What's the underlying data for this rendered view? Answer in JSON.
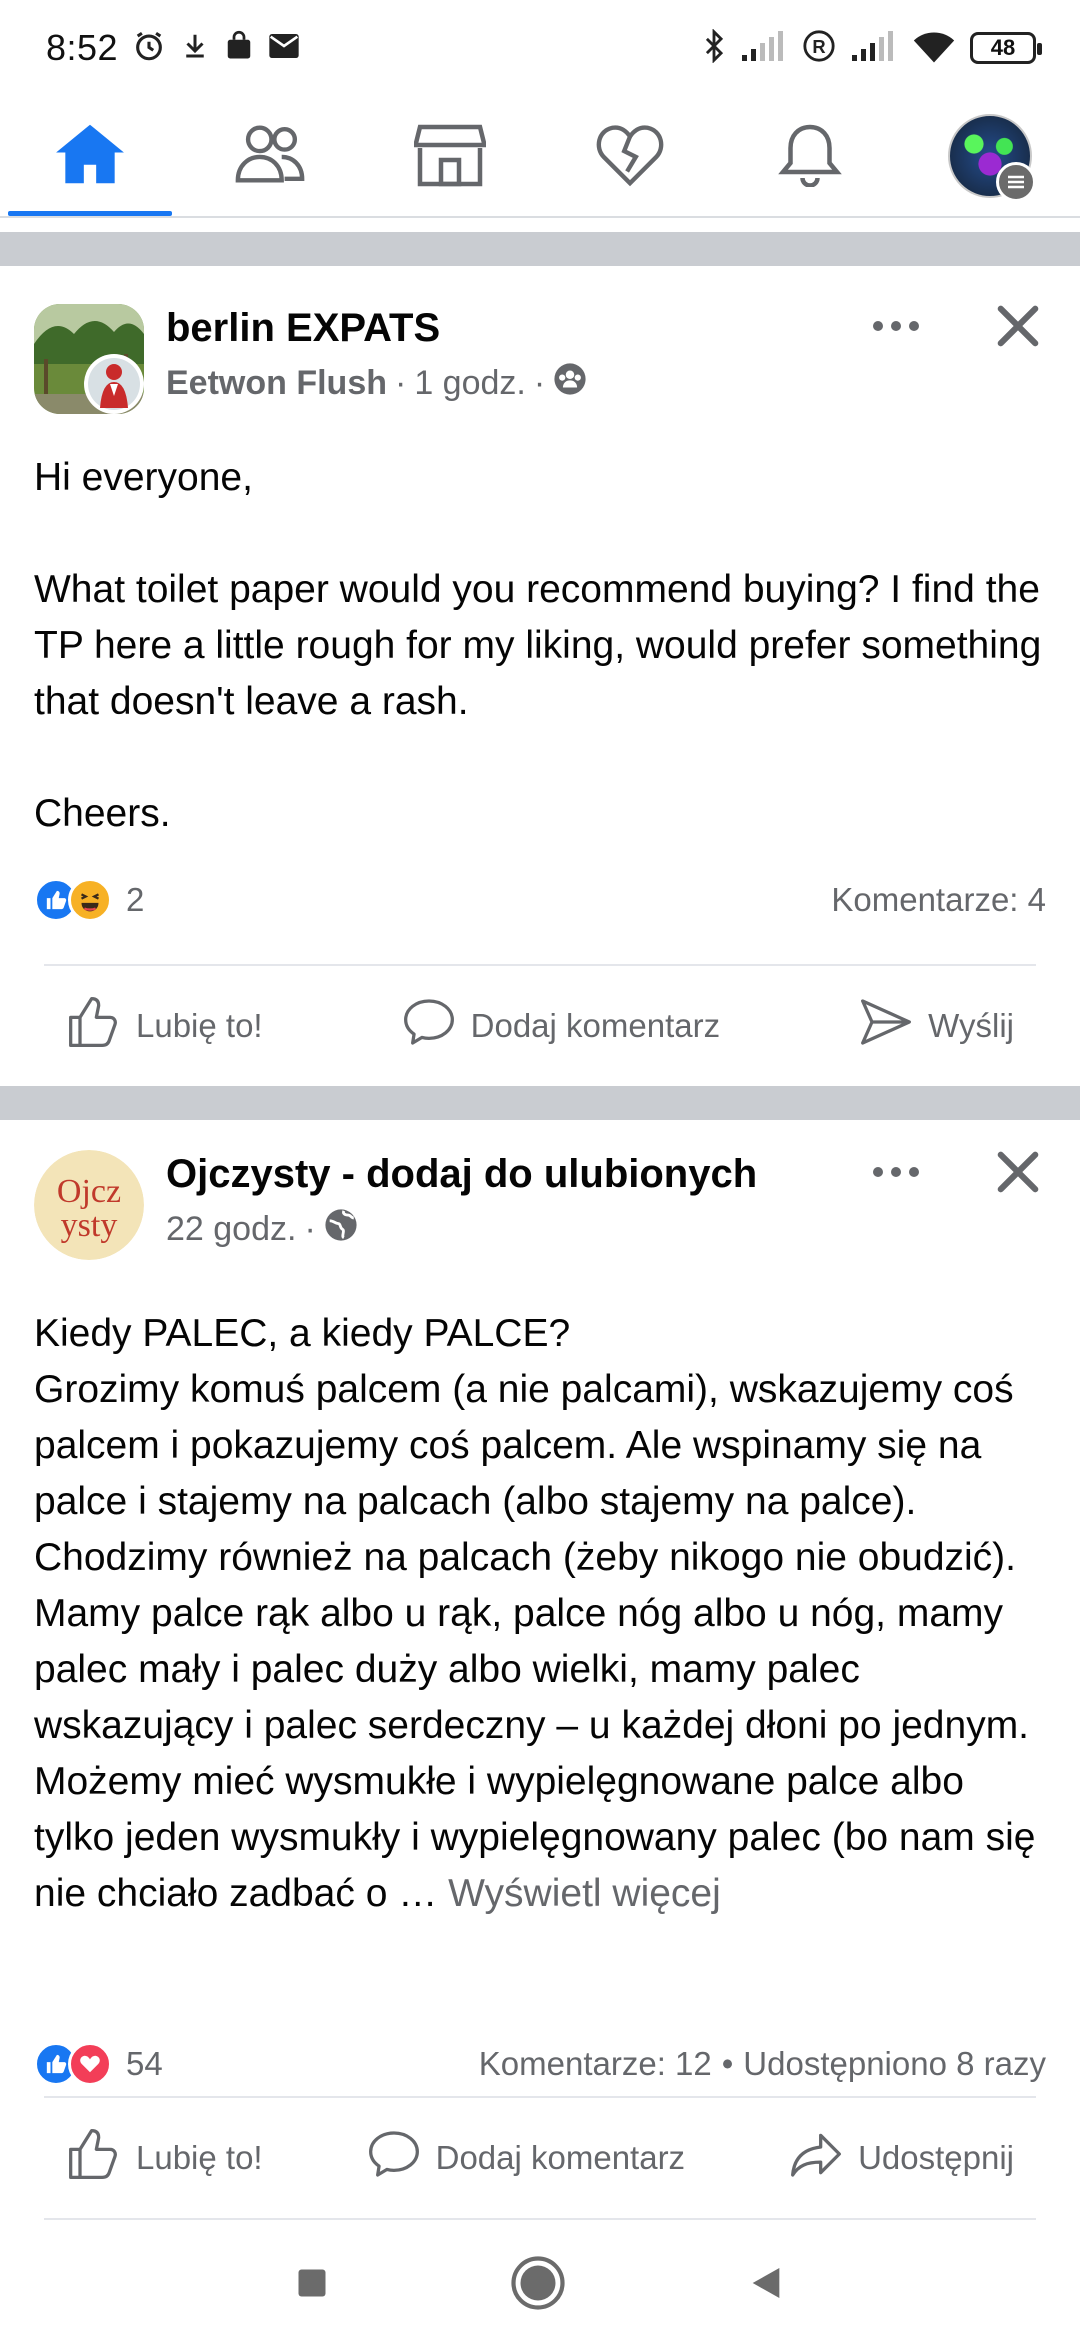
{
  "status_bar": {
    "time": "8:52",
    "battery": "48",
    "icons": [
      "alarm-icon",
      "download-icon",
      "shopping-bag-icon",
      "mail-icon",
      "bluetooth-icon",
      "signal-icon",
      "roaming-icon",
      "signal-icon",
      "wifi-icon",
      "battery-icon"
    ]
  },
  "nav": {
    "items": [
      "home-icon",
      "friends-icon",
      "marketplace-icon",
      "dating-icon",
      "notifications-icon",
      "profile-menu"
    ],
    "active": "home-icon",
    "accent": "#1877f2"
  },
  "posts": [
    {
      "title": "berlin EXPATS",
      "author": "Eetwon Flush",
      "time": "1 godz.",
      "privacy_icon": "group-icon",
      "body": "Hi everyone,\n\nWhat toilet paper would you recommend buying? I find the TP here a little rough for my liking, would prefer something that doesn't leave a rash.\n\nCheers.",
      "reactions_count": "2",
      "reaction_icons": [
        "like-icon",
        "haha-icon"
      ],
      "comments": "Komentarze: 4",
      "shares": "",
      "actions": [
        "Lubię to!",
        "Dodaj komentarz",
        "Wyślij"
      ]
    },
    {
      "title": "Ojczysty - dodaj do ulubionych",
      "avatar_text_top": "Ojcz",
      "avatar_text_bottom": "ysty",
      "time": "22 godz.",
      "privacy_icon": "globe-icon",
      "body": "Kiedy PALEC, a kiedy PALCE?\nGrozimy komuś palcem (a nie palcami), wskazujemy coś palcem i pokazujemy coś palcem. Ale wspinamy się na palce i stajemy na palcach (albo stajemy na palce). Chodzimy również na palcach (żeby nikogo nie obudzić). Mamy palce rąk albo u rąk, palce nóg albo u nóg, mamy palec mały i palec duży albo wielki, mamy palec wskazujący i palec serdeczny – u każdej dłoni po jednym. Możemy mieć wysmukłe i wypielęgnowane palce albo tylko jeden wysmukły i wypielęgnowany palec (bo nam się nie chciało zadbać o … ",
      "see_more": "Wyświetl więcej",
      "reactions_count": "54",
      "reaction_icons": [
        "like-icon",
        "love-icon"
      ],
      "comments": "Komentarze: 12",
      "shares": "Udostępniono 8 razy",
      "actions": [
        "Lubię to!",
        "Dodaj komentarz",
        "Udostępnij"
      ]
    }
  ],
  "system_nav": [
    "recents-icon",
    "home-circle-icon",
    "back-icon"
  ]
}
